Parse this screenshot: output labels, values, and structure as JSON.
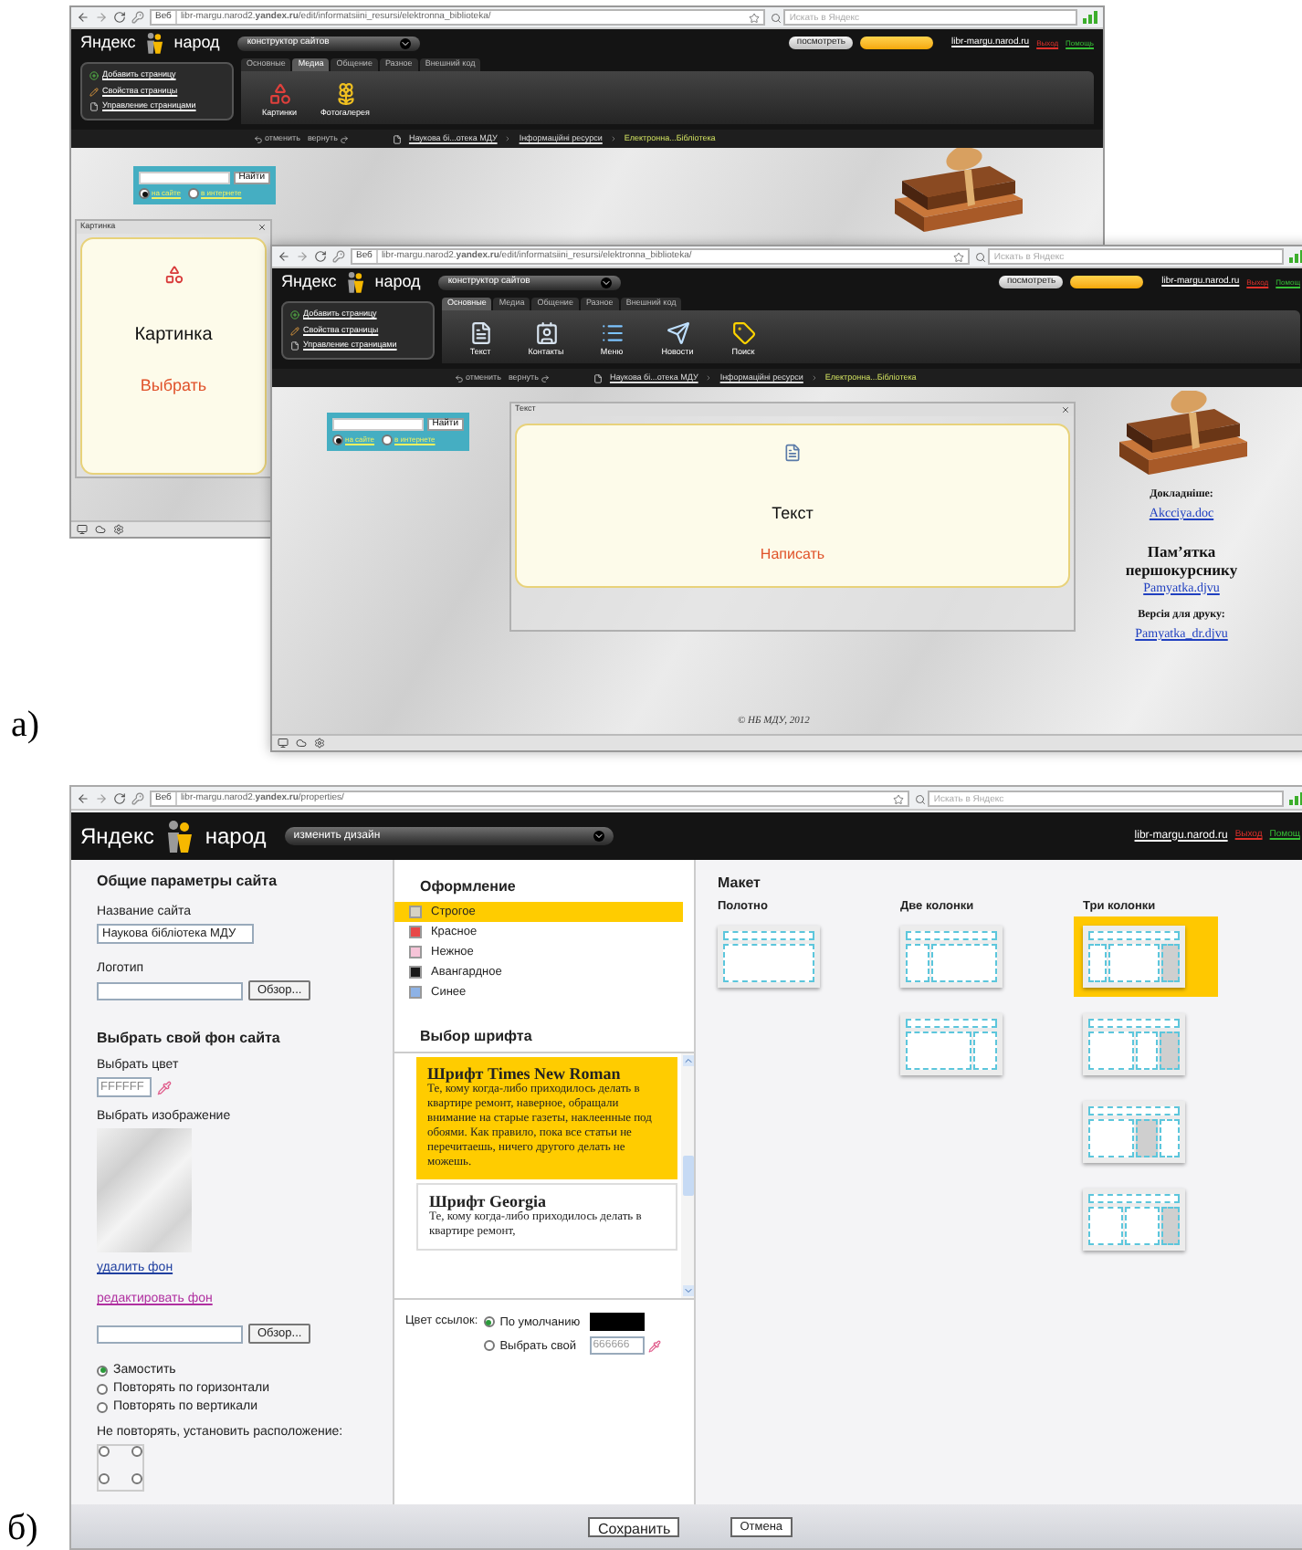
{
  "part_a": {
    "label": "а)",
    "back_window": {
      "browser": {
        "web": "Веб",
        "url": "libr-margu.narod2.**yandex.ru**/edit/informatsiini_resursi/elektronna_biblioteka/",
        "search_placeholder": "Искать в Яндекс"
      },
      "header": {
        "logo": [
          "Яндекс",
          "народ"
        ],
        "mode": "конструктор сайтов",
        "actions": [
          {
            "kind": "gray",
            "label": "посмотреть"
          },
          {
            "kind": "yellow"
          }
        ],
        "site": "libr-margu.narod.ru",
        "logout": "Выход",
        "help": "Помощь"
      },
      "editor": {
        "menu": [
          {
            "kind": "add",
            "label": "Добавить страницу"
          },
          {
            "kind": "edit",
            "label": "Свойства страницы"
          },
          {
            "kind": "pages",
            "label": "Управление страницами"
          }
        ],
        "tabs": [
          {
            "label": "Основные",
            "selected": false
          },
          {
            "label": "Медиа",
            "selected": true
          },
          {
            "label": "Общение",
            "selected": false
          },
          {
            "label": "Разное",
            "selected": false
          },
          {
            "label": "Внешний код",
            "selected": false
          }
        ],
        "tools": [
          {
            "kind": "pictures",
            "label": "Картинки"
          },
          {
            "kind": "gallery",
            "label": "Фотогалерея"
          }
        ]
      },
      "breadcrumb": {
        "undo": "отменить",
        "redo": "вернуть",
        "path": [
          "Наукова бі...отека МДУ",
          "Інформаційні ресурси",
          "Електронна...Бібліотека"
        ]
      },
      "search_widget": {
        "button": "Найти",
        "options": [
          {
            "label": "на сайте",
            "selected": true
          },
          {
            "label": "в интернете",
            "selected": false
          }
        ]
      },
      "widget": {
        "title": "Картинка",
        "kind": "picture",
        "name": "Картинка",
        "action": "Выбрать"
      }
    },
    "front_window": {
      "browser": {
        "web": "Веб",
        "url": "libr-margu.narod2.**yandex.ru**/edit/informatsiini_resursi/elektronna_biblioteka/",
        "search_placeholder": "Искать в Яндекс"
      },
      "header": {
        "logo": [
          "Яндекс",
          "народ"
        ],
        "mode": "конструктор сайтов",
        "actions": [
          {
            "kind": "gray",
            "label": "посмотреть"
          },
          {
            "kind": "yellow"
          }
        ],
        "site": "libr-margu.narod.ru",
        "logout": "Выход",
        "help": "Помощ"
      },
      "editor": {
        "menu": [
          {
            "kind": "add",
            "label": "Добавить страницу"
          },
          {
            "kind": "edit",
            "label": "Свойства страницы"
          },
          {
            "kind": "pages",
            "label": "Управление страницами"
          }
        ],
        "tabs": [
          {
            "label": "Основные",
            "selected": true
          },
          {
            "label": "Медиа",
            "selected": false
          },
          {
            "label": "Общение",
            "selected": false
          },
          {
            "label": "Разное",
            "selected": false
          },
          {
            "label": "Внешний код",
            "selected": false
          }
        ],
        "tools": [
          {
            "kind": "text",
            "label": "Текст"
          },
          {
            "kind": "contacts",
            "label": "Контакты"
          },
          {
            "kind": "menu",
            "label": "Меню"
          },
          {
            "kind": "news",
            "label": "Новости"
          },
          {
            "kind": "search",
            "label": "Поиск"
          }
        ]
      },
      "breadcrumb": {
        "undo": "отменить",
        "redo": "вернуть",
        "path": [
          "Наукова бі...отека МДУ",
          "Інформаційні ресурси",
          "Електронна...Бібліотека"
        ]
      },
      "search_widget": {
        "button": "Найти",
        "options": [
          {
            "label": "на сайте",
            "selected": true
          },
          {
            "label": "в интернете",
            "selected": false
          }
        ]
      },
      "widget": {
        "title": "Текст",
        "kind": "text",
        "name": "Текст",
        "action": "Написать"
      },
      "sidebar": [
        {
          "kind": "note",
          "text": "Докладніше:"
        },
        {
          "kind": "link",
          "text": "Akcciya.doc"
        },
        {
          "kind": "heading",
          "text": "Пам’ятка першокурснику"
        },
        {
          "kind": "link",
          "text": "Pamyatka.djvu"
        },
        {
          "kind": "note",
          "text": "Версія для друку:"
        },
        {
          "kind": "link",
          "text": "Pamyatka_dr.djvu"
        }
      ],
      "footer": "© НБ МДУ, 2012"
    }
  },
  "part_b": {
    "label": "б)",
    "browser": {
      "web": "Веб",
      "url": "libr-margu.narod2.**yandex.ru**/properties/",
      "search_placeholder": "Искать в Яндекс"
    },
    "header": {
      "logo": [
        "Яндекс",
        "народ"
      ],
      "mode": "изменить дизайн",
      "site": "libr-margu.narod.ru",
      "logout": "Выход",
      "help": "Помощ"
    },
    "general": {
      "title": "Общие параметры сайта",
      "site_name_label": "Название сайта",
      "site_name": "Наукова бібліотека МДУ",
      "logo_label": "Логотип",
      "browse": "Обзор..."
    },
    "background": {
      "title": "Выбрать свой фон сайта",
      "color_label": "Выбрать цвет",
      "color_value": "FFFFFF",
      "image_label": "Выбрать изображение",
      "delete_link": "удалить фон",
      "edit_link": "редактировать фон",
      "browse": "Обзор...",
      "repeat_options": [
        {
          "label": "Замостить",
          "selected": true
        },
        {
          "label": "Повторять по горизонтали",
          "selected": false
        },
        {
          "label": "Повторять по вертикали",
          "selected": false
        }
      ],
      "position_label": "Не повторять, установить расположение:",
      "positions": [
        {
          "selected": false
        },
        {
          "selected": false
        },
        {
          "selected": false
        },
        {
          "selected": false
        }
      ]
    },
    "design": {
      "title": "Оформление",
      "themes": [
        {
          "label": "Строгое",
          "selected": true,
          "color": "#d6d2c4"
        },
        {
          "label": "Красное",
          "selected": false,
          "color": "#e84848"
        },
        {
          "label": "Нежное",
          "selected": false,
          "color": "#f6c4d8"
        },
        {
          "label": "Авангардное",
          "selected": false,
          "color": "#1a1a1a"
        },
        {
          "label": "Синее",
          "selected": false,
          "color": "#8db2e6"
        }
      ]
    },
    "fonts": {
      "title": "Выбор шрифта",
      "items": [
        {
          "name": "Шрифт Times New Roman",
          "sample": "Те, кому когда-либо приходилось делать в квартире ремонт, наверное, обращали внимание на старые газеты, наклеенные под обоями. Как правило, пока все статьи не перечитаешь, ничего другого делать не можешь.",
          "selected": true
        },
        {
          "name": "Шрифт Georgia",
          "sample": "Те, кому когда-либо приходилось делать в квартире ремонт,",
          "selected": false
        }
      ]
    },
    "link_color": {
      "label": "Цвет ссылок:",
      "options": [
        {
          "label": "По умолчанию",
          "selected": true
        },
        {
          "label": "Выбрать свой",
          "selected": false
        }
      ],
      "custom_value": "666666"
    },
    "layout": {
      "title": "Макет",
      "groups": [
        {
          "label": "Полотно",
          "options": [
            {
              "kind": "full",
              "selected": false
            }
          ]
        },
        {
          "label": "Две колонки",
          "options": [
            {
              "kind": "left-narrow",
              "selected": false
            },
            {
              "kind": "right-narrow",
              "selected": false
            }
          ]
        },
        {
          "label": "Три колонки",
          "options": [
            {
              "kind": "three-sides",
              "selected": true
            },
            {
              "kind": "three-right-pair",
              "selected": false
            },
            {
              "kind": "three-middle-shaded",
              "selected": false
            },
            {
              "kind": "three-right-shaded",
              "selected": false
            }
          ]
        }
      ]
    },
    "buttons": [
      "Сохранить",
      "Отмена"
    ]
  }
}
